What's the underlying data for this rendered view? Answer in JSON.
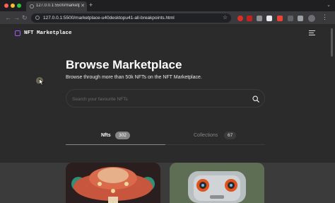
{
  "browser": {
    "tab_title": "127.0.0.1:5500/marketplace-",
    "url": "127.0.0.1:5500/marketplace-u40desktopu41-all-breakpoints.html"
  },
  "header": {
    "logo_text": "NFT Marketplace"
  },
  "hero": {
    "title": "Browse Marketplace",
    "subtitle": "Browse through more than 50k NFTs on the NFT Marketplace."
  },
  "search": {
    "placeholder": "Search your favourite NFTs",
    "value": ""
  },
  "tabs": [
    {
      "label": "Nfts",
      "count": "302",
      "active": true
    },
    {
      "label": "Collections",
      "count": "67",
      "active": false
    }
  ],
  "colors": {
    "accent": "#a259ff",
    "background": "#2b2b2b",
    "active_tab_pill": "#858584"
  }
}
